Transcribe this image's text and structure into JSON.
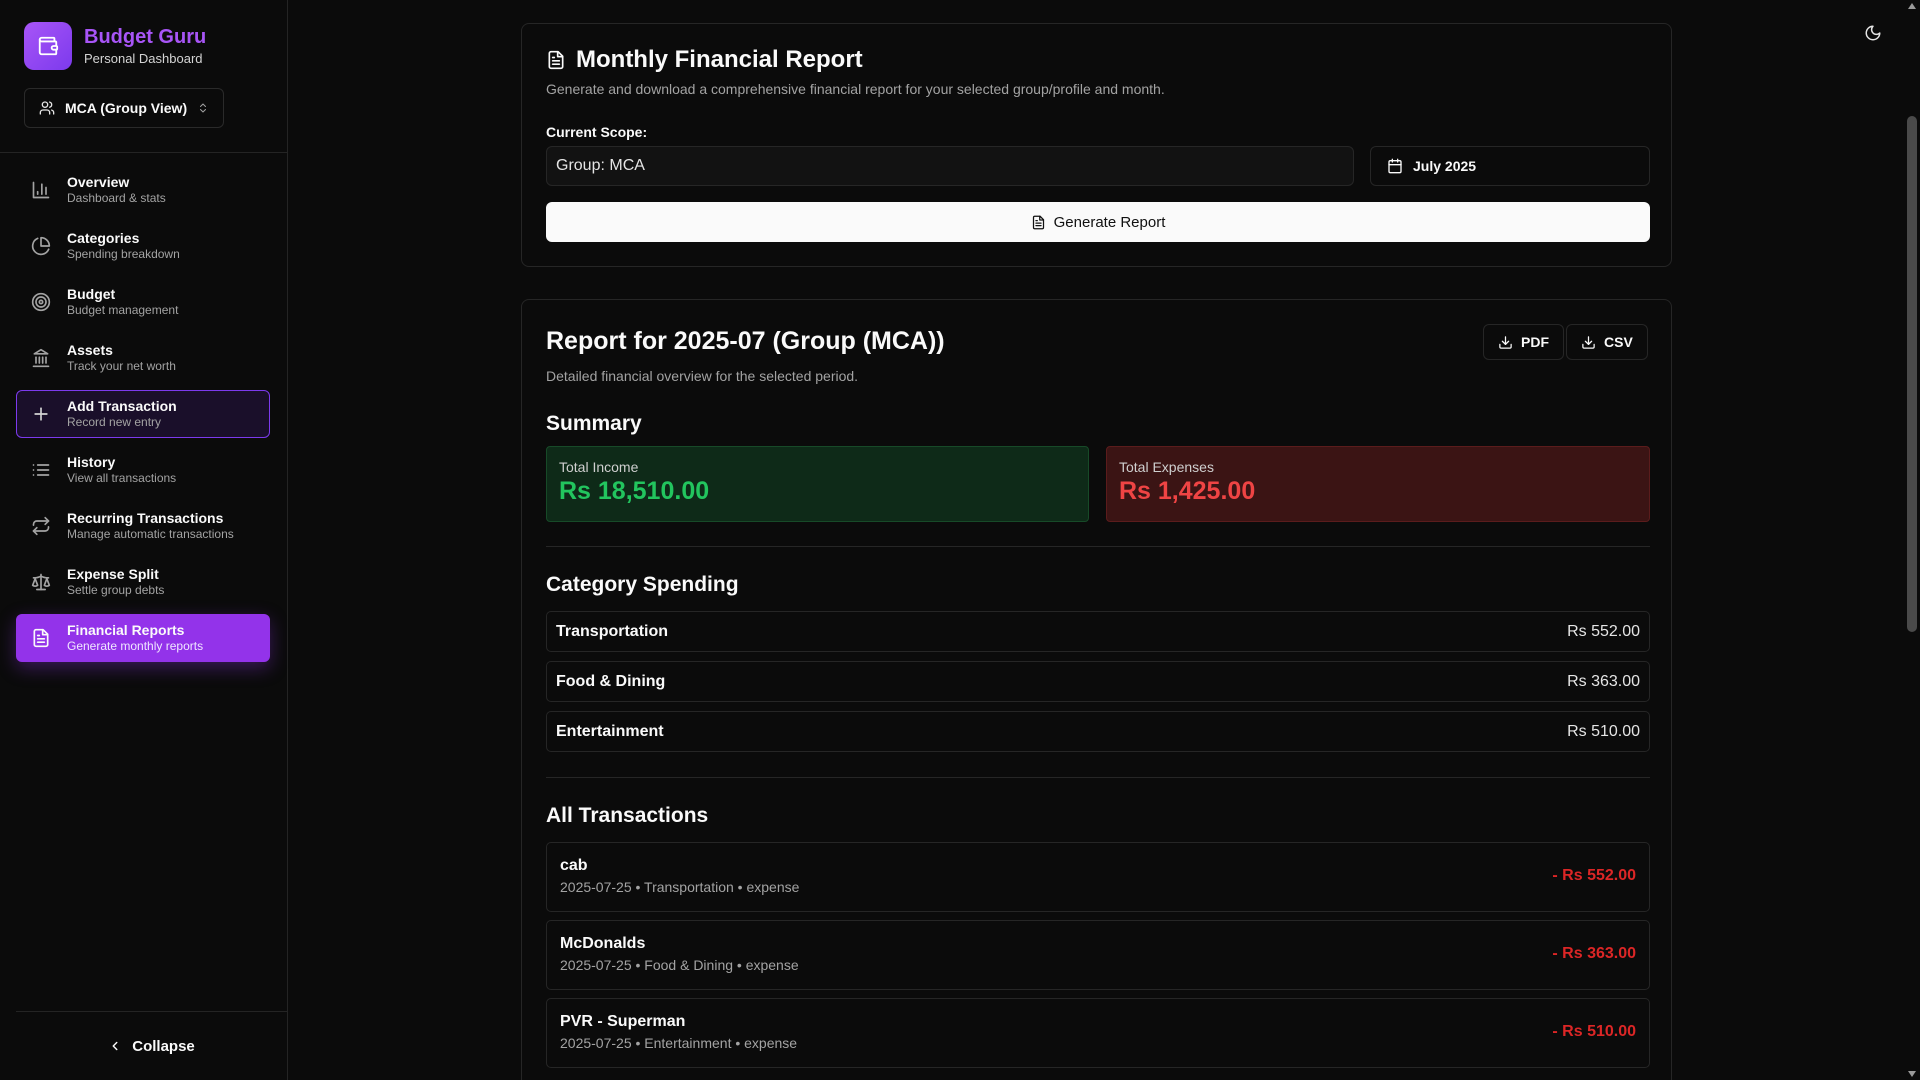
{
  "brand": {
    "name": "Budget Guru",
    "subtitle": "Personal Dashboard"
  },
  "scope_selector": {
    "label": "MCA (Group View)"
  },
  "nav": [
    {
      "title": "Overview",
      "desc": "Dashboard & stats",
      "icon": "bar-chart-icon"
    },
    {
      "title": "Categories",
      "desc": "Spending breakdown",
      "icon": "pie-chart-icon"
    },
    {
      "title": "Budget",
      "desc": "Budget management",
      "icon": "target-icon"
    },
    {
      "title": "Assets",
      "desc": "Track your net worth",
      "icon": "bank-icon"
    },
    {
      "title": "Add Transaction",
      "desc": "Record new entry",
      "icon": "plus-icon"
    },
    {
      "title": "History",
      "desc": "View all transactions",
      "icon": "list-icon"
    },
    {
      "title": "Recurring Transactions",
      "desc": "Manage automatic transactions",
      "icon": "repeat-icon"
    },
    {
      "title": "Expense Split",
      "desc": "Settle group debts",
      "icon": "scale-icon"
    },
    {
      "title": "Financial Reports",
      "desc": "Generate monthly reports",
      "icon": "file-text-icon"
    }
  ],
  "collapse_label": "Collapse",
  "report_generator": {
    "title": "Monthly Financial Report",
    "description": "Generate and download a comprehensive financial report for your selected group/profile and month.",
    "scope_label": "Current Scope:",
    "scope_value": "Group: MCA",
    "month": "July 2025",
    "generate_label": "Generate Report"
  },
  "report": {
    "title": "Report for 2025-07 (Group (MCA))",
    "subtitle": "Detailed financial overview for the selected period.",
    "pdf_label": "PDF",
    "csv_label": "CSV",
    "summary_heading": "Summary",
    "income_label": "Total Income",
    "income_value": "Rs 18,510.00",
    "expense_label": "Total Expenses",
    "expense_value": "Rs 1,425.00",
    "category_heading": "Category Spending",
    "categories": [
      {
        "name": "Transportation",
        "amount": "Rs 552.00"
      },
      {
        "name": "Food & Dining",
        "amount": "Rs 363.00"
      },
      {
        "name": "Entertainment",
        "amount": "Rs 510.00"
      }
    ],
    "transactions_heading": "All Transactions",
    "transactions": [
      {
        "name": "cab",
        "meta": "2025-07-25 • Transportation • expense",
        "amount": "- Rs 552.00"
      },
      {
        "name": "McDonalds",
        "meta": "2025-07-25 • Food & Dining • expense",
        "amount": "- Rs 363.00"
      },
      {
        "name": "PVR - Superman",
        "meta": "2025-07-25 • Entertainment • expense",
        "amount": "- Rs 510.00"
      }
    ]
  },
  "colors": {
    "accent": "#9333ea",
    "brand_text": "#a855f7",
    "income": "#22c55e",
    "expense": "#ef4444"
  }
}
